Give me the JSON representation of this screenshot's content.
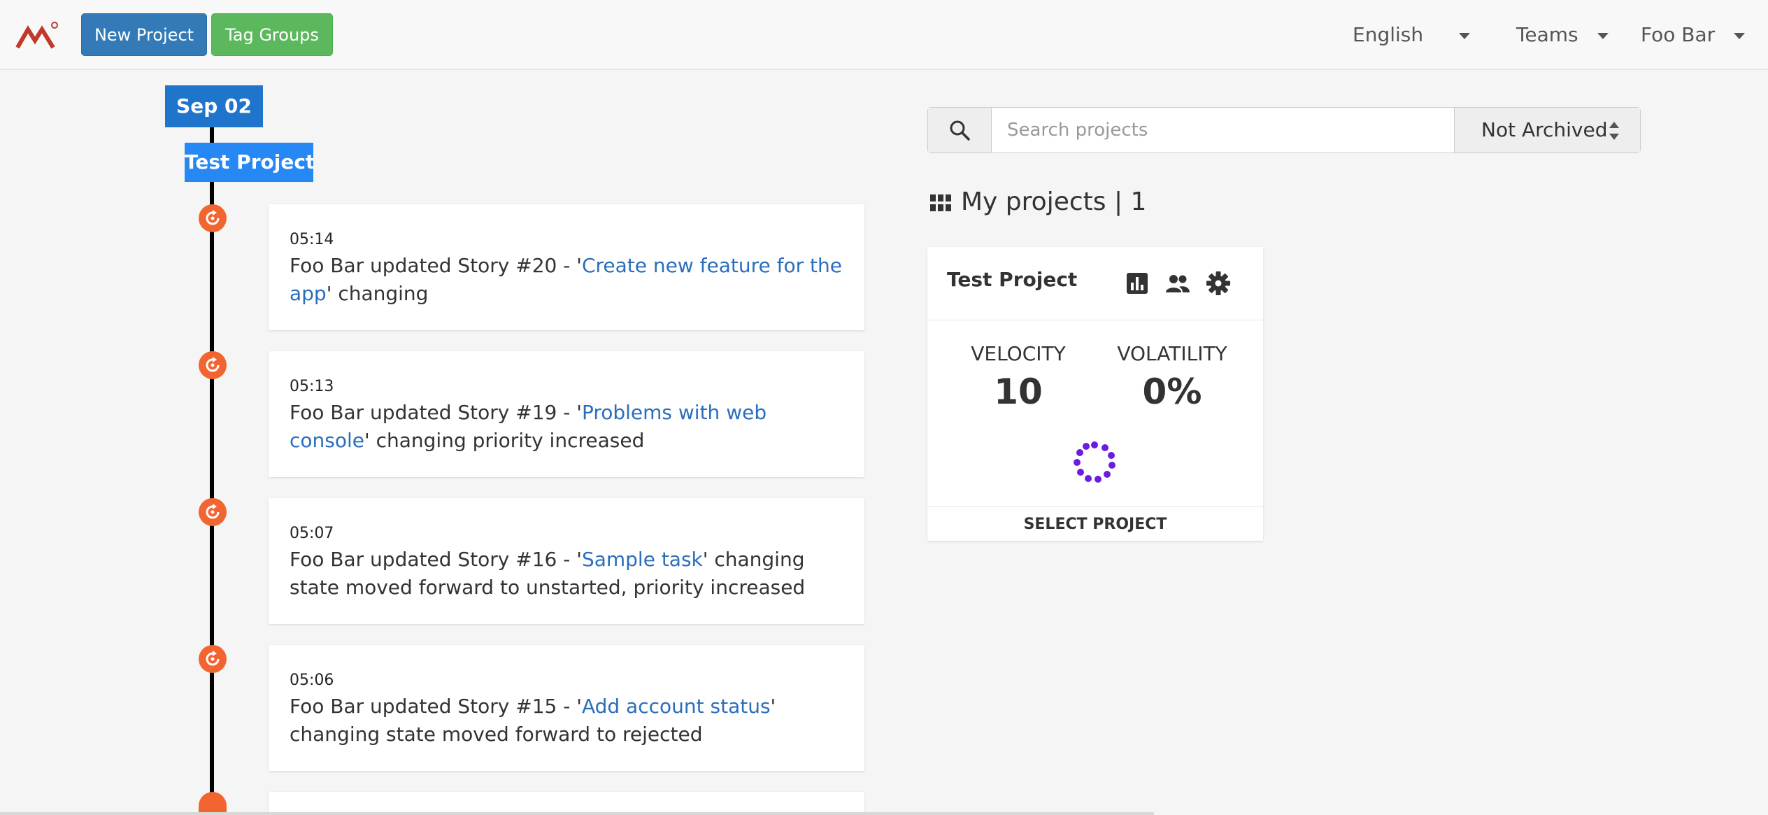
{
  "header": {
    "new_project_label": "New Project",
    "tag_groups_label": "Tag Groups",
    "language_label": "English",
    "teams_label": "Teams",
    "user_label": "Foo Bar"
  },
  "timeline": {
    "date": "Sep 02",
    "project": "Test Project",
    "entries": [
      {
        "time": "05:14",
        "prefix": "Foo Bar updated Story #20 - '",
        "link": "Create new feature for the app",
        "suffix": "' changing"
      },
      {
        "time": "05:13",
        "prefix": "Foo Bar updated Story #19 - '",
        "link": "Problems with web console",
        "suffix": "' changing priority increased"
      },
      {
        "time": "05:07",
        "prefix": "Foo Bar updated Story #16 - '",
        "link": "Sample task",
        "suffix": "' changing state moved forward to unstarted, priority increased"
      },
      {
        "time": "05:06",
        "prefix": "Foo Bar updated Story #15 - '",
        "link": "Add account status",
        "suffix": "' changing state moved forward to rejected"
      }
    ]
  },
  "search": {
    "placeholder": "Search projects",
    "value": "",
    "archive_filter": "Not Archived"
  },
  "projects": {
    "title": "My projects | 1",
    "card": {
      "name": "Test Project",
      "velocity_label": "VELOCITY",
      "velocity_value": "10",
      "volatility_label": "VOLATILITY",
      "volatility_value": "0%",
      "select_label": "SELECT PROJECT"
    }
  },
  "colors": {
    "primary": "#337ab7",
    "success": "#5cb85c",
    "timeline_icon": "#f26531",
    "date_badge": "#1f75cb",
    "project_badge": "#2688f5",
    "link": "#2a6ebb",
    "spinner": "#6a1de0"
  },
  "icons": {
    "logo": "brand-logo",
    "timeline": "refresh-icon",
    "search": "search-icon",
    "projects": "grid-icon",
    "card_actions": [
      "bar-chart-icon",
      "people-icon",
      "gear-icon"
    ],
    "loading": "spinner-icon"
  }
}
